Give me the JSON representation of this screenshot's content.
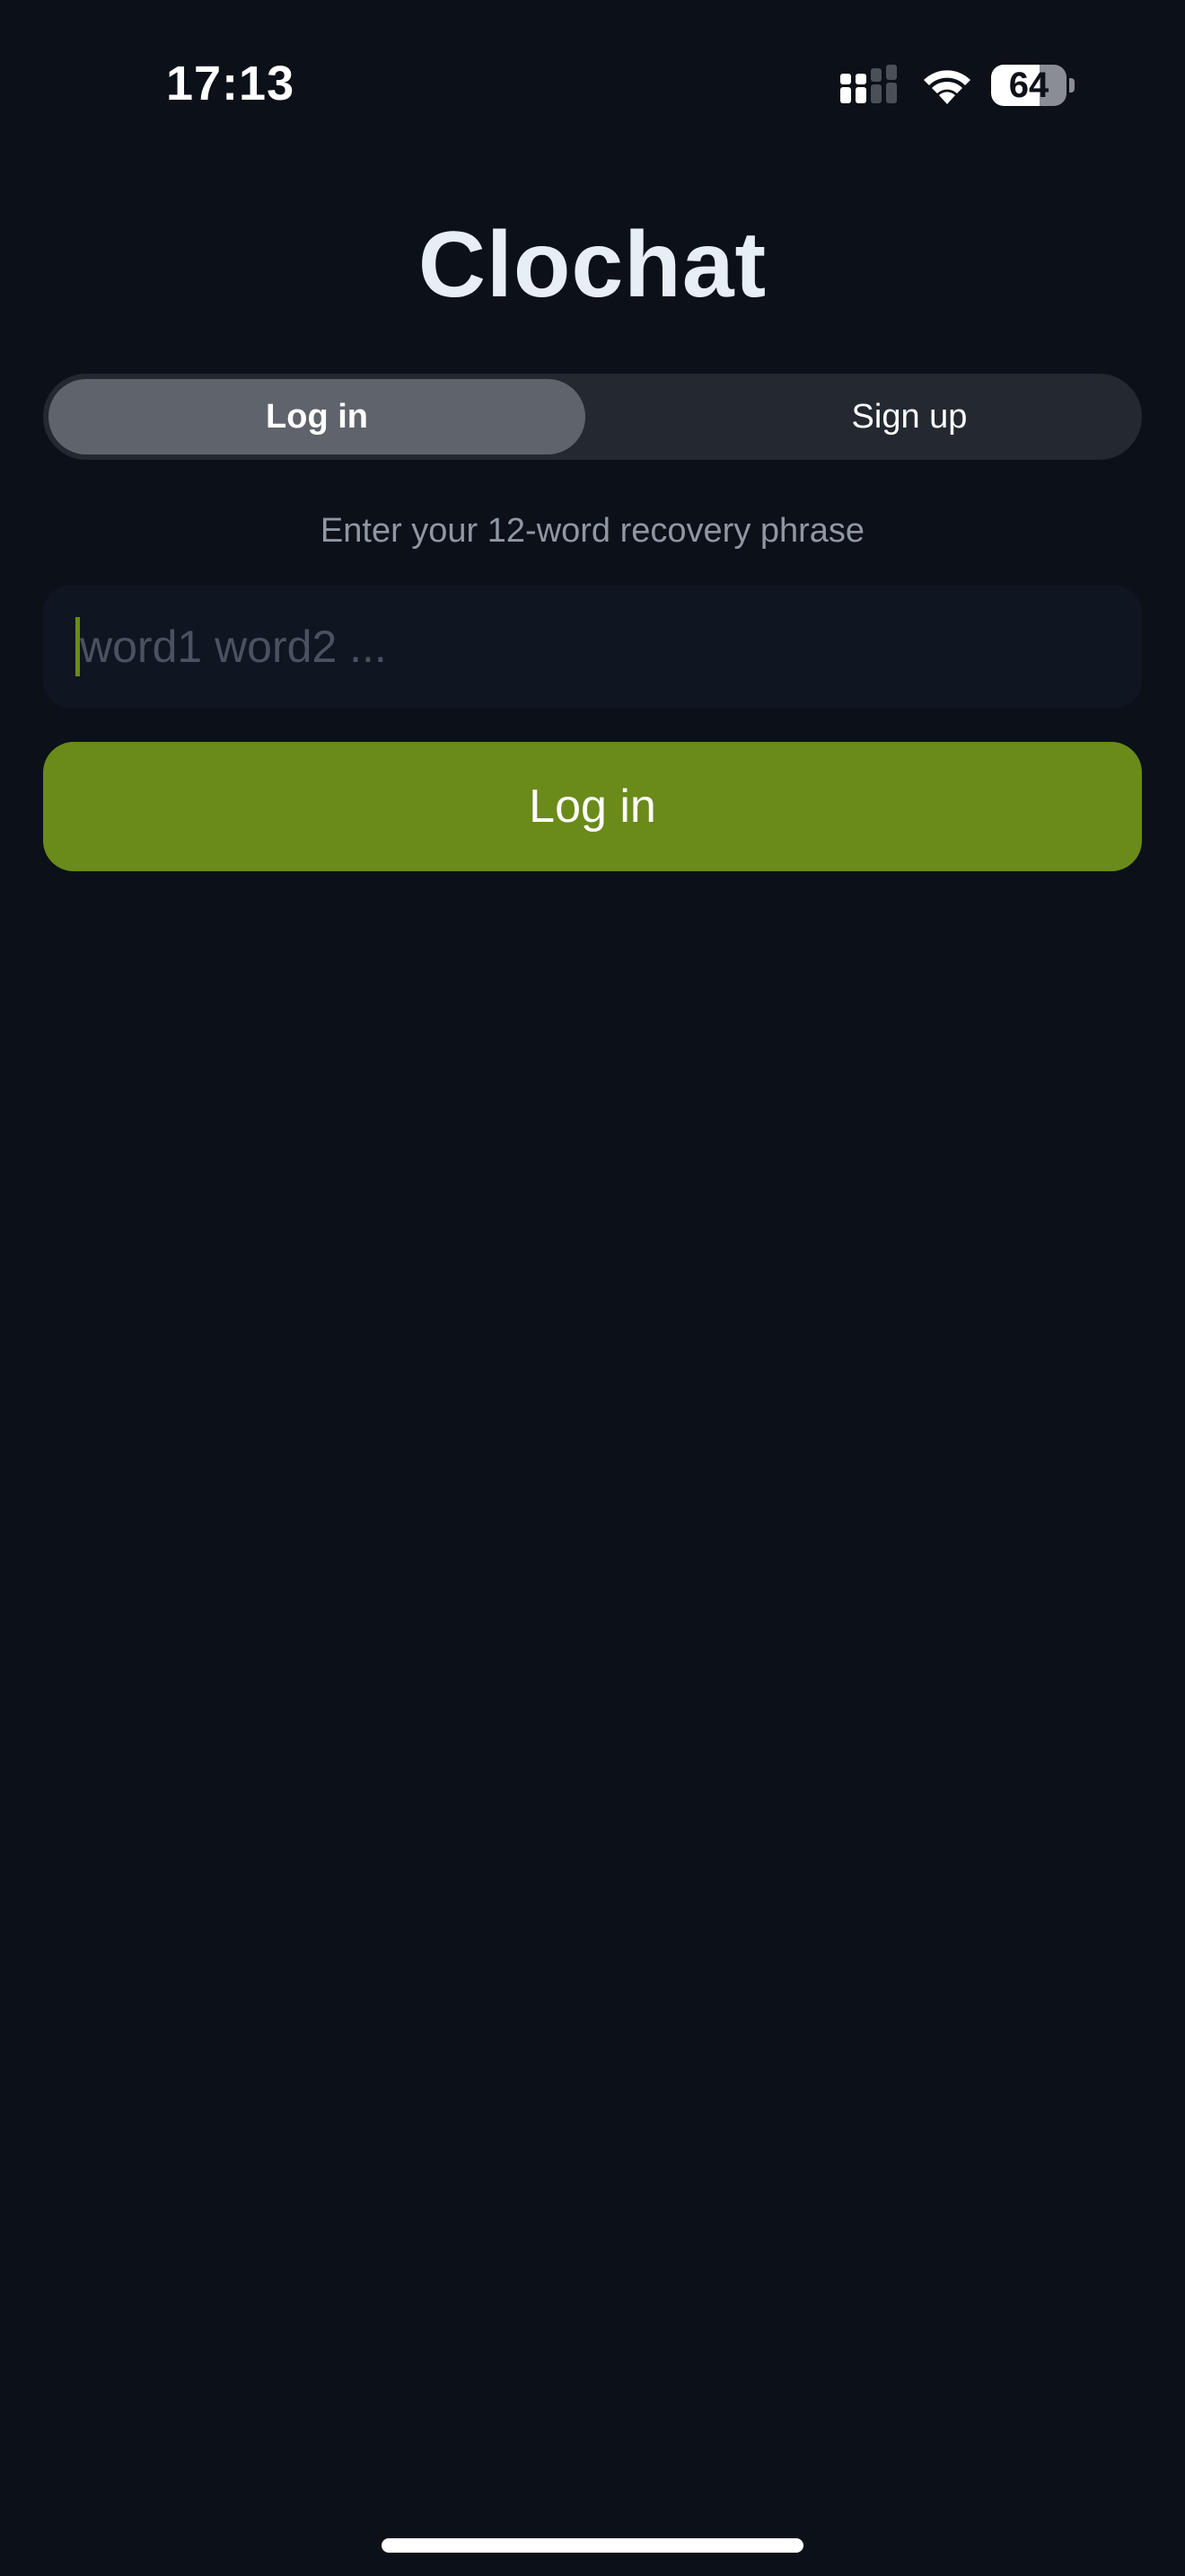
{
  "status_bar": {
    "time": "17:13",
    "battery_level": "64",
    "battery_fraction": 0.64,
    "icons": [
      "cellular-signal-icon",
      "wifi-icon",
      "battery-icon"
    ]
  },
  "app": {
    "title": "Clochat"
  },
  "tabs": [
    {
      "label": "Log in",
      "selected": true
    },
    {
      "label": "Sign up",
      "selected": false
    }
  ],
  "form": {
    "helper_text": "Enter your 12-word recovery phrase",
    "phrase_value": "",
    "phrase_placeholder": "word1 word2 ...",
    "submit_label": "Log in"
  },
  "colors": {
    "background": "#0c1018",
    "accent": "#6a8a1a",
    "segmented_bg": "#242831",
    "segmented_active": "#5f636b",
    "helper_text": "#8f97a3"
  }
}
